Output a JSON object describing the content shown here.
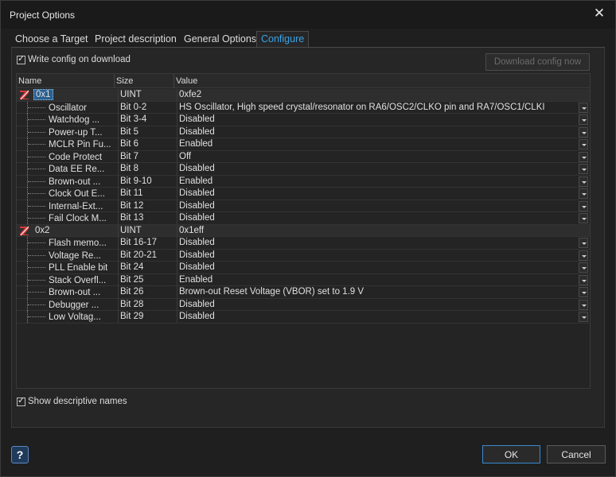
{
  "window": {
    "title": "Project Options"
  },
  "tabs": [
    {
      "label": "Choose a Target"
    },
    {
      "label": "Project description"
    },
    {
      "label": "General Options"
    },
    {
      "label": "Configure"
    }
  ],
  "options": {
    "write_config": "Write config on download",
    "download_button": "Download config now",
    "show_descriptive": "Show descriptive names"
  },
  "grid": {
    "headers": {
      "name": "Name",
      "size": "Size",
      "value": "Value"
    },
    "groups": [
      {
        "name": "0x1",
        "size": "UINT",
        "value": "0xfe2",
        "rows": [
          {
            "name": "Oscillator",
            "size": "Bit 0-2",
            "value": "HS Oscillator, High speed crystal/resonator on RA6/OSC2/CLKO pin and RA7/OSC1/CLKI"
          },
          {
            "name": "Watchdog ...",
            "size": "Bit 3-4",
            "value": "Disabled"
          },
          {
            "name": "Power-up T...",
            "size": "Bit 5",
            "value": "Disabled"
          },
          {
            "name": "MCLR Pin Fu...",
            "size": "Bit 6",
            "value": "Enabled"
          },
          {
            "name": "Code Protect",
            "size": "Bit 7",
            "value": "Off"
          },
          {
            "name": "Data EE Re...",
            "size": "Bit 8",
            "value": "Disabled"
          },
          {
            "name": "Brown-out ...",
            "size": "Bit 9-10",
            "value": "Enabled"
          },
          {
            "name": "Clock Out E...",
            "size": "Bit 11",
            "value": "Disabled"
          },
          {
            "name": "Internal-Ext...",
            "size": "Bit 12",
            "value": "Disabled"
          },
          {
            "name": "Fail Clock M...",
            "size": "Bit 13",
            "value": "Disabled"
          }
        ]
      },
      {
        "name": "0x2",
        "size": "UINT",
        "value": "0x1eff",
        "rows": [
          {
            "name": "Flash memo...",
            "size": "Bit 16-17",
            "value": "Disabled"
          },
          {
            "name": "Voltage Re...",
            "size": "Bit 20-21",
            "value": "Disabled"
          },
          {
            "name": "PLL Enable bit",
            "size": "Bit 24",
            "value": "Disabled"
          },
          {
            "name": "Stack Overfl...",
            "size": "Bit 25",
            "value": "Enabled"
          },
          {
            "name": "Brown-out ...",
            "size": "Bit 26",
            "value": "Brown-out Reset Voltage (VBOR) set to 1.9 V"
          },
          {
            "name": "Debugger ...",
            "size": "Bit 28",
            "value": "Disabled"
          },
          {
            "name": "Low Voltag...",
            "size": "Bit 29",
            "value": "Disabled"
          }
        ]
      }
    ]
  },
  "footer": {
    "ok": "OK",
    "cancel": "Cancel"
  },
  "icons": {
    "close": "close-icon",
    "help": "help-icon",
    "group": "register-icon"
  }
}
